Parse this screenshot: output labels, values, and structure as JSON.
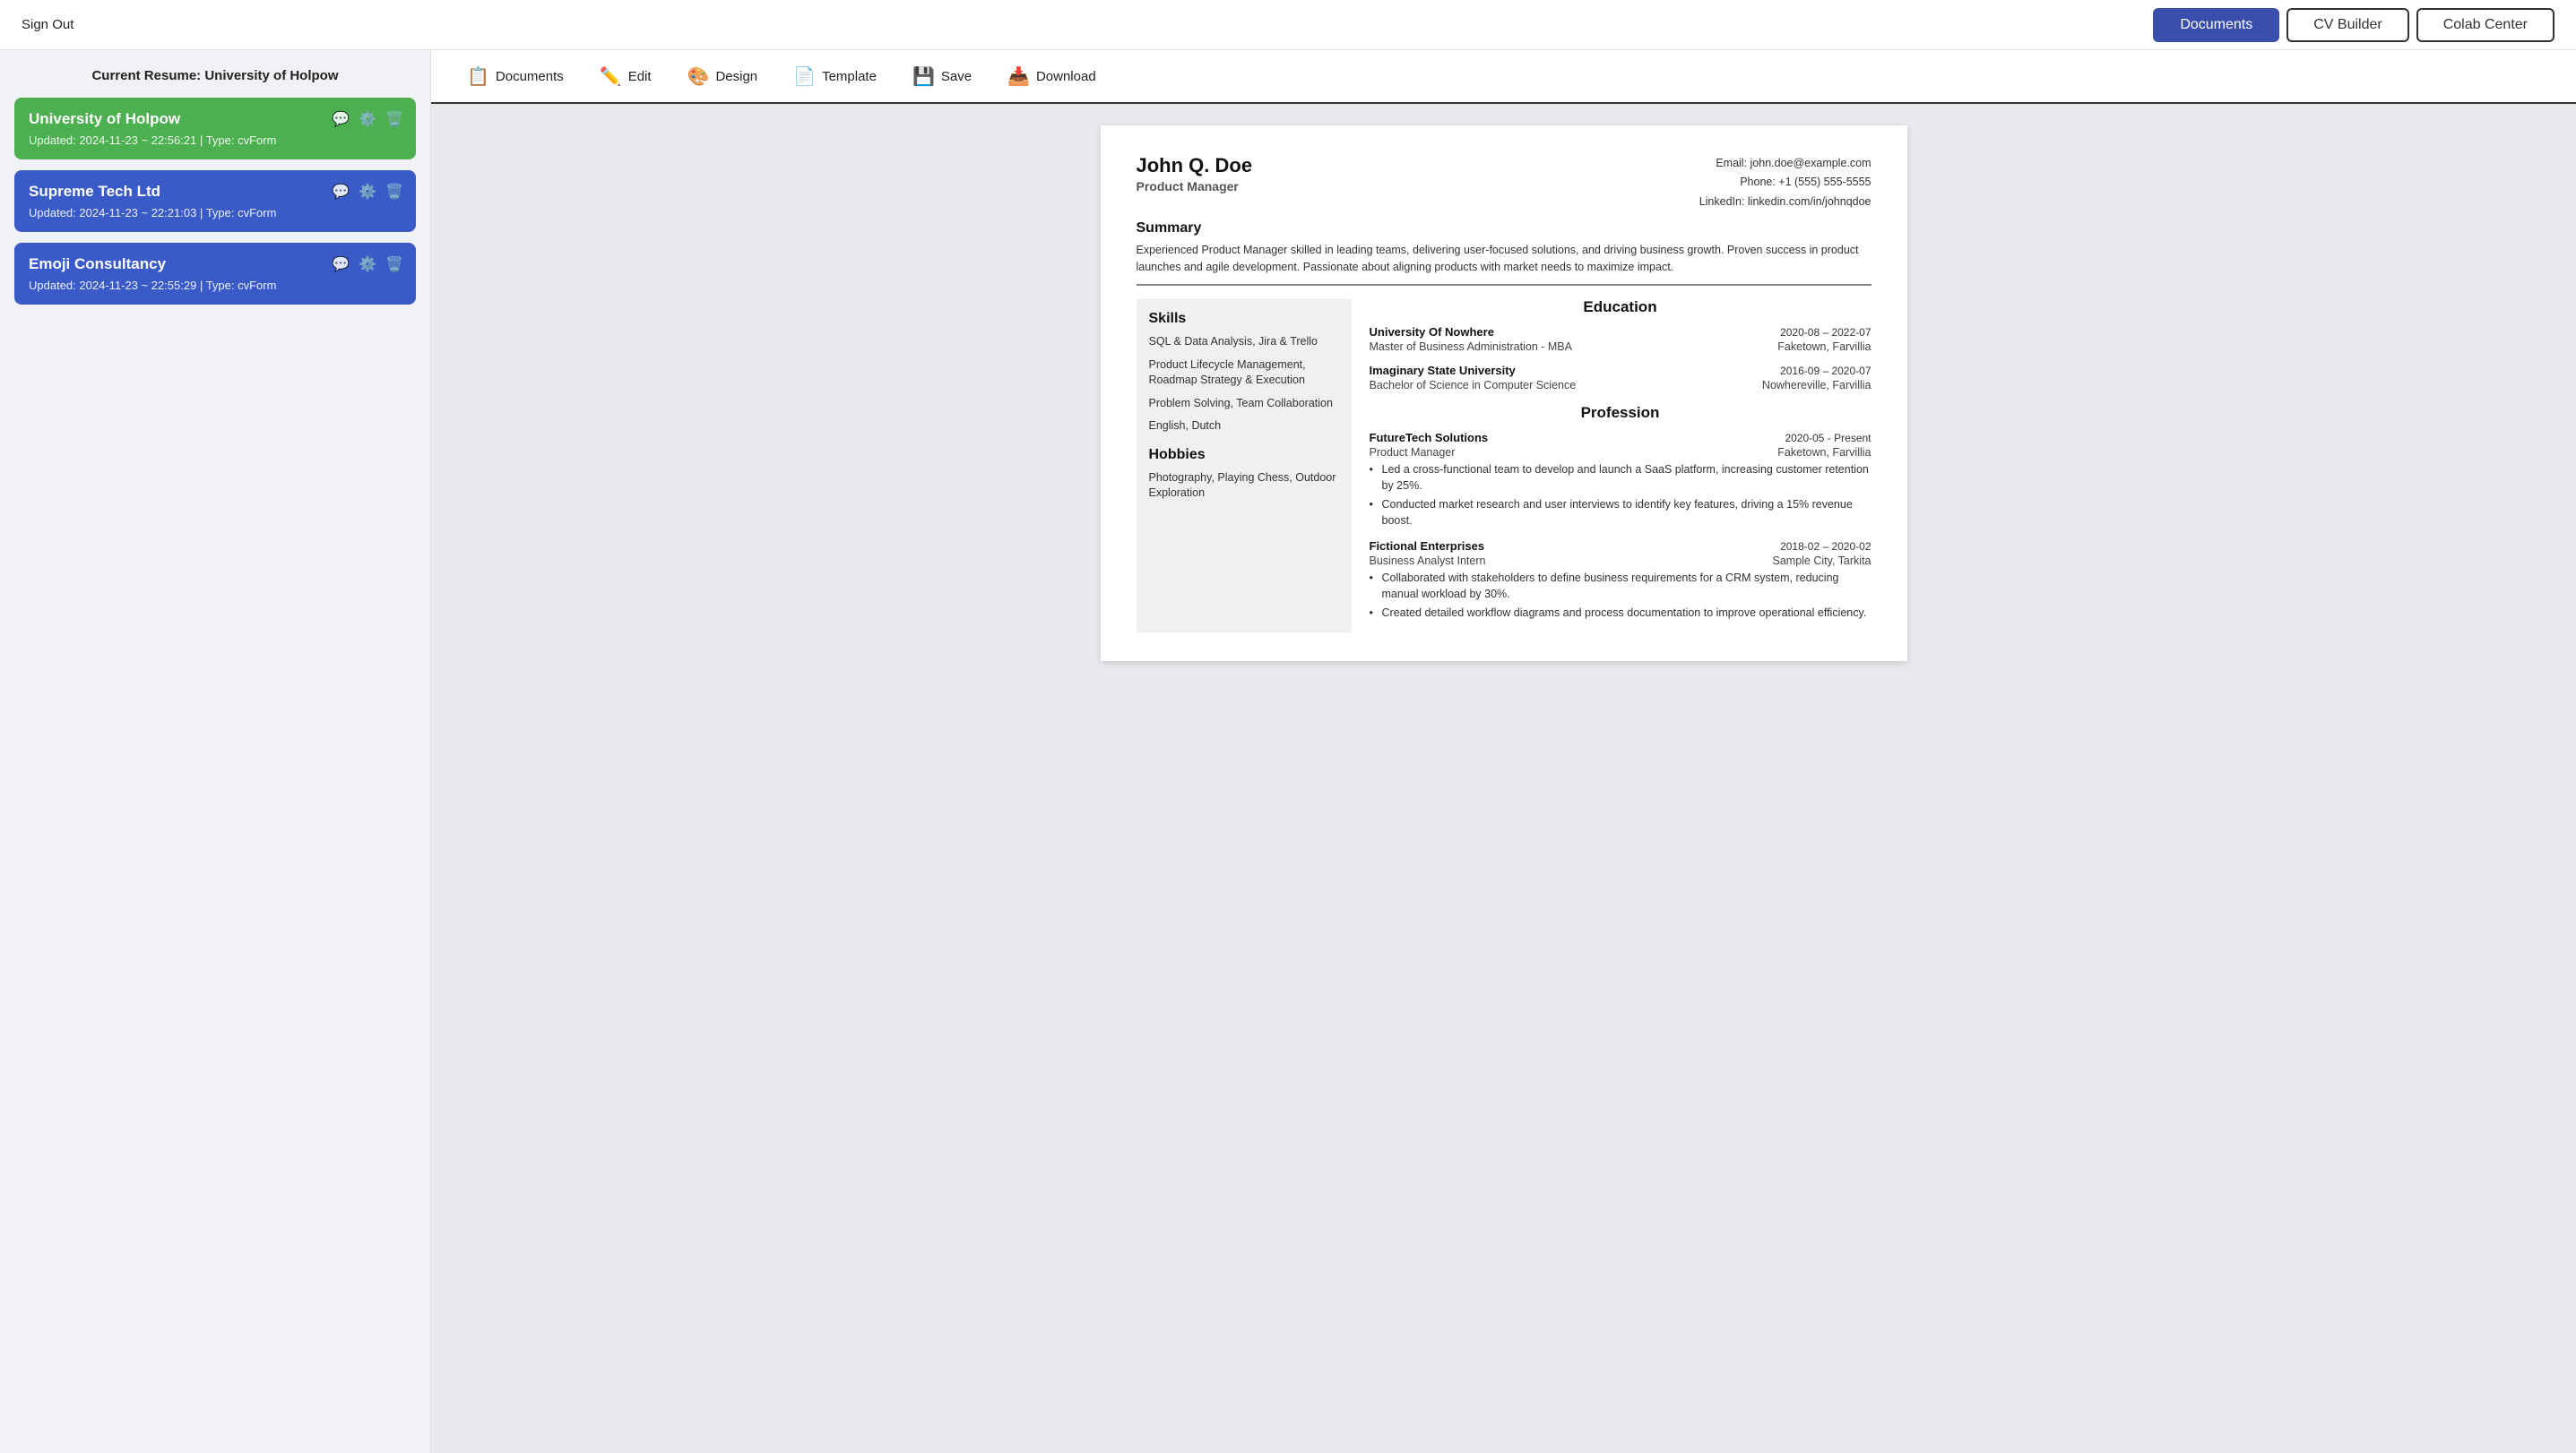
{
  "topNav": {
    "signOut": "Sign Out",
    "buttons": [
      {
        "label": "Documents",
        "active": true
      },
      {
        "label": "CV Builder",
        "active": false
      },
      {
        "label": "Colab Center",
        "active": false
      }
    ]
  },
  "sidebar": {
    "title": "Current Resume: University of Holpow",
    "cards": [
      {
        "id": "card-1",
        "title": "University of Holpow",
        "meta": "Updated: 2024-11-23 ~ 22:56:21   |   Type: cvForm",
        "style": "active"
      },
      {
        "id": "card-2",
        "title": "Supreme Tech Ltd",
        "meta": "Updated: 2024-11-23 ~ 22:21:03   |   Type: cvForm",
        "style": "blue"
      },
      {
        "id": "card-3",
        "title": "Emoji Consultancy",
        "meta": "Updated: 2024-11-23 ~ 22:55:29   |   Type: cvForm",
        "style": "blue"
      }
    ]
  },
  "toolbar": {
    "items": [
      {
        "label": "Documents",
        "icon": "📋"
      },
      {
        "label": "Edit",
        "icon": "✏️"
      },
      {
        "label": "Design",
        "icon": "🎨"
      },
      {
        "label": "Template",
        "icon": "📄"
      },
      {
        "label": "Save",
        "icon": "💾"
      },
      {
        "label": "Download",
        "icon": "📥"
      }
    ]
  },
  "resume": {
    "name": "John Q. Doe",
    "jobTitle": "Product Manager",
    "contact": {
      "email": "Email: john.doe@example.com",
      "phone": "Phone: +1 (555) 555-5555",
      "linkedin": "LinkedIn: linkedin.com/in/johnqdoe"
    },
    "summary": {
      "heading": "Summary",
      "text": "Experienced Product Manager skilled in leading teams, delivering user-focused solutions, and driving business growth. Proven success in product launches and agile development. Passionate about aligning products with market needs to maximize impact."
    },
    "skills": {
      "heading": "Skills",
      "items": [
        "SQL & Data Analysis, Jira & Trello",
        "Product Lifecycle Management, Roadmap Strategy & Execution",
        "Problem Solving, Team Collaboration",
        "English, Dutch"
      ]
    },
    "hobbies": {
      "heading": "Hobbies",
      "items": [
        "Photography, Playing Chess, Outdoor Exploration"
      ]
    },
    "education": {
      "heading": "Education",
      "entries": [
        {
          "name": "University Of Nowhere",
          "dates": "2020-08 – 2022-07",
          "degree": "Master of Business Administration - MBA",
          "location": "Faketown, Farvillia"
        },
        {
          "name": "Imaginary State University",
          "dates": "2016-09 – 2020-07",
          "degree": "Bachelor of Science in Computer Science",
          "location": "Nowhereville, Farvillia"
        }
      ]
    },
    "profession": {
      "heading": "Profession",
      "entries": [
        {
          "company": "FutureTech Solutions",
          "dates": "2020-05 - Present",
          "role": "Product Manager",
          "location": "Faketown, Farvillia",
          "bullets": [
            "Led a cross-functional team to develop and launch a SaaS platform, increasing customer retention by 25%.",
            "Conducted market research and user interviews to identify key features, driving a 15% revenue boost."
          ]
        },
        {
          "company": "Fictional Enterprises",
          "dates": "2018-02 – 2020-02",
          "role": "Business Analyst Intern",
          "location": "Sample City, Tarkita",
          "bullets": [
            "Collaborated with stakeholders to define business requirements for a CRM system, reducing manual workload by 30%.",
            "Created detailed workflow diagrams and process documentation to improve operational efficiency."
          ]
        }
      ]
    }
  }
}
